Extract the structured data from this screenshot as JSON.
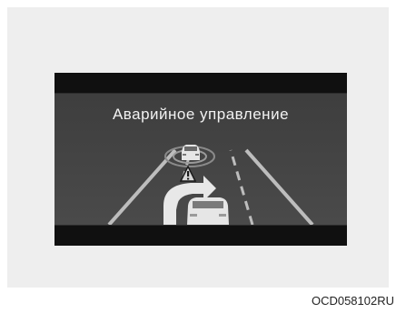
{
  "display": {
    "title": "Аварийное управление"
  },
  "caption": {
    "code": "OCD058102RU"
  },
  "colors": {
    "screen_background": "#444444",
    "frame": "#0c0c0c",
    "text": "#f2f2f2",
    "lane_line": "#bdbdbd",
    "warning_triangle": "#d8d8d8",
    "panel_background": "#eeeeee"
  },
  "icons": {
    "obstacle_car": "car-rear-icon",
    "warning": "warning-triangle-icon",
    "steer": "curved-arrow-right-icon",
    "own_vehicle": "car-rear-icon"
  }
}
